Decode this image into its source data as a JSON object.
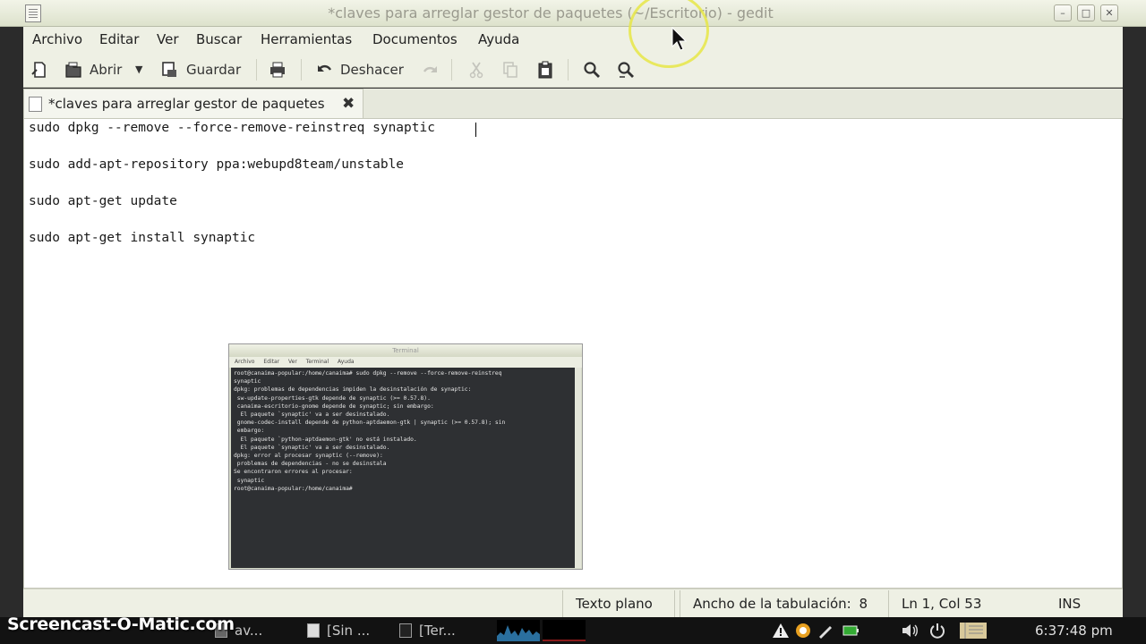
{
  "window": {
    "title": "*claves para arreglar gestor de paquetes (~/Escritorio) - gedit",
    "minimize_label": "–",
    "maximize_label": "□",
    "close_label": "✕"
  },
  "menu": {
    "items": [
      "Archivo",
      "Editar",
      "Ver",
      "Buscar",
      "Herramientas",
      "Documentos",
      "Ayuda"
    ]
  },
  "toolbar": {
    "open_label": "Abrir",
    "save_label": "Guardar",
    "undo_label": "Deshacer"
  },
  "tab": {
    "label": "*claves para arreglar gestor de paquetes",
    "close_label": "✖"
  },
  "editor": {
    "lines": [
      "sudo dpkg --remove --force-remove-reinstreq synaptic",
      "sudo add-apt-repository ppa:webupd8team/unstable",
      "sudo apt-get update",
      "sudo apt-get install synaptic"
    ]
  },
  "terminal": {
    "title": "Terminal",
    "menu": [
      "Archivo",
      "Editar",
      "Ver",
      "Terminal",
      "Ayuda"
    ],
    "lines": [
      "root@canaima-popular:/home/canaima# sudo dpkg --remove --force-remove-reinstreq",
      "synaptic",
      "dpkg: problemas de dependencias impiden la desinstalación de synaptic:",
      " sw-update-properties-gtk depende de synaptic (>= 0.57.8).",
      " canaima-escritorio-gnome depende de synaptic; sin embargo:",
      "  El paquete `synaptic' va a ser desinstalado.",
      " gnome-codec-install depende de python-aptdaemon-gtk | synaptic (>= 0.57.8); sin",
      " embargo:",
      "  El paquete `python-aptdaemon-gtk' no está instalado.",
      "  El paquete `synaptic' va a ser desinstalado.",
      "dpkg: error al procesar synaptic (--remove):",
      " problemas de dependencias - no se desinstala",
      "Se encontraron errores al procesar:",
      " synaptic",
      "root@canaima-popular:/home/canaima#"
    ]
  },
  "status": {
    "language": "Texto plano",
    "tab_width_label": "Ancho de la tabulación:",
    "tab_width_value": "8",
    "position": "Ln 1, Col 53",
    "mode": "INS"
  },
  "panel": {
    "watermark": "Screencast-O-Matic.com",
    "tasks": [
      "av...",
      "[Sin ...",
      "[Ter..."
    ],
    "clock": "6:37:48 pm"
  },
  "colors": {
    "title_bg": "#e6e9d6",
    "editor_bg": "#ffffff",
    "terminal_bg": "#2e3033",
    "panel_bg": "#121212",
    "cursor_highlight": "#e6e646"
  }
}
